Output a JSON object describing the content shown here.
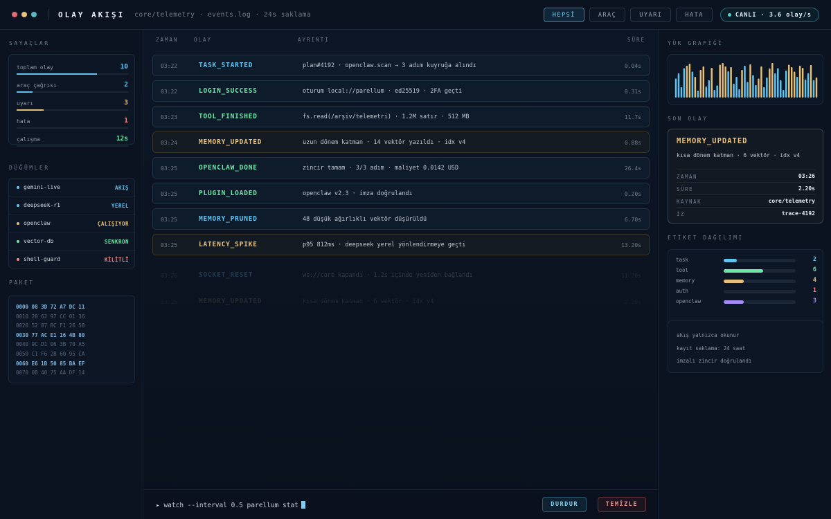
{
  "header": {
    "title": "OLAY AKIŞI",
    "path": "core/telemetry · events.log · 24s saklama",
    "filters": [
      {
        "label": "HEPSİ",
        "active": true
      },
      {
        "label": "ARAÇ",
        "active": false
      },
      {
        "label": "UYARI",
        "active": false
      },
      {
        "label": "HATA",
        "active": false
      }
    ],
    "live": "CANLI · 3.6 olay/s",
    "dot_colors": [
      "#e06c75",
      "#e5c07b",
      "#56b6c2"
    ]
  },
  "counters": {
    "title": "SAYAÇLAR",
    "rows": [
      {
        "label": "toplam olay",
        "value": "10",
        "color": "#61c3f0",
        "fill": 0.72
      },
      {
        "label": "araç çağrısı",
        "value": "2",
        "color": "#61c3f0",
        "fill": 0.14
      },
      {
        "label": "uyarı",
        "value": "3",
        "color": "#e5c07b",
        "fill": 0.24
      },
      {
        "label": "hata",
        "value": "1",
        "color": "#f08a8a",
        "fill": 0.0
      },
      {
        "label": "çalışma",
        "value": "12s",
        "color": "#6ee7a8",
        "fill": 0.0
      }
    ]
  },
  "nodes": {
    "title": "DÜĞÜMLER",
    "rows": [
      {
        "name": "gemini-live",
        "status": "AKIŞ",
        "color": "#61c3f0"
      },
      {
        "name": "deepseek-r1",
        "status": "YEREL",
        "color": "#61c3f0"
      },
      {
        "name": "openclaw",
        "status": "ÇALIŞIYOR",
        "color": "#e5c07b"
      },
      {
        "name": "vector-db",
        "status": "SENKRON",
        "color": "#6ee7a8"
      },
      {
        "name": "shell-guard",
        "status": "KİLİTLİ",
        "color": "#f08a8a"
      }
    ]
  },
  "packet": {
    "title": "PAKET",
    "lines": [
      {
        "text": "0000 08 3D 72 A7 DC 11",
        "highlight": true
      },
      {
        "text": "0010 20 62 97 CC 01 36",
        "highlight": false
      },
      {
        "text": "0020 52 87 BC F1 26 5B",
        "highlight": false
      },
      {
        "text": "0030 77 AC E1 16 4B 80",
        "highlight": true
      },
      {
        "text": "0040 9C D1 06 3B 70 A5",
        "highlight": false
      },
      {
        "text": "0050 C1 F6 2B 60 95 CA",
        "highlight": false
      },
      {
        "text": "0060 E6 1B 50 85 BA EF",
        "highlight": true
      },
      {
        "text": "0070 0B 40 75 AA DF 14",
        "highlight": false
      }
    ]
  },
  "table": {
    "columns": [
      "ZAMAN",
      "OLAY",
      "AYRINTI",
      "SÜRE"
    ],
    "rows": [
      {
        "time": "03:22",
        "name": "TASK_STARTED",
        "detail": "plan#4192 · openclaw.scan → 3 adım kuyruğa alındı",
        "dur": "0.04s",
        "color": "#61c3f0",
        "kind": "info"
      },
      {
        "time": "03:22",
        "name": "LOGIN_SUCCESS",
        "detail": "oturum local://parellum · ed25519 · 2FA geçti",
        "dur": "0.31s",
        "color": "#6ee7a8",
        "kind": "info"
      },
      {
        "time": "03:23",
        "name": "TOOL_FINISHED",
        "detail": "fs.read(/arşiv/telemetri) · 1.2M satır · 512 MB",
        "dur": "11.7s",
        "color": "#6ee7a8",
        "kind": "info"
      },
      {
        "time": "03:24",
        "name": "MEMORY_UPDATED",
        "detail": "uzun dönem katman · 14 vektör yazıldı · idx v4",
        "dur": "0.88s",
        "color": "#e5c07b",
        "kind": "warn"
      },
      {
        "time": "03:25",
        "name": "OPENCLAW_DONE",
        "detail": "zincir tamam · 3/3 adım · maliyet 0.0142 USD",
        "dur": "26.4s",
        "color": "#6ee7a8",
        "kind": "info"
      },
      {
        "time": "03:25",
        "name": "PLUGIN_LOADED",
        "detail": "openclaw v2.3 · imza doğrulandı",
        "dur": "0.20s",
        "color": "#6ee7a8",
        "kind": "info"
      },
      {
        "time": "03:25",
        "name": "MEMORY_PRUNED",
        "detail": "48 düşük ağırlıklı vektör düşürüldü",
        "dur": "6.70s",
        "color": "#61c3f0",
        "kind": "info"
      },
      {
        "time": "03:25",
        "name": "LATENCY_SPIKE",
        "detail": "p95 812ms · deepseek yerel yönlendirmeye geçti",
        "dur": "13.20s",
        "color": "#e5c07b",
        "kind": "warn"
      },
      {
        "time": "03:26",
        "name": "SOCKET_RESET",
        "detail": "ws://core kapandı · 1.2s içinde yeniden bağlandı",
        "dur": "11.20s",
        "color": "#61c3f0",
        "kind": "fade",
        "opacity": 0.22
      },
      {
        "time": "03:26",
        "name": "MEMORY_UPDATED",
        "detail": "kısa dönem katman · 6 vektör · idx v4",
        "dur": "2.20s",
        "color": "#e5c07b",
        "kind": "fade",
        "opacity": 0.12
      }
    ]
  },
  "command": {
    "prompt": "▸ watch --interval 0.5 parellum stat",
    "stop": "DURDUR",
    "clear": "TEMİZLE"
  },
  "load_chart": {
    "title": "YÜK GRAFİĞİ",
    "bars": [
      {
        "v": 0.55,
        "c": "#61c3f0"
      },
      {
        "v": 0.7,
        "c": "#61c3f0"
      },
      {
        "v": 0.3,
        "c": "#61c3f0"
      },
      {
        "v": 0.85,
        "c": "#61c3f0"
      },
      {
        "v": 0.92,
        "c": "#e5c07b"
      },
      {
        "v": 0.98,
        "c": "#e5c07b"
      },
      {
        "v": 0.75,
        "c": "#61c3f0"
      },
      {
        "v": 0.6,
        "c": "#e5c07b"
      },
      {
        "v": 0.2,
        "c": "#61c3f0"
      },
      {
        "v": 0.8,
        "c": "#e5c07b"
      },
      {
        "v": 0.9,
        "c": "#e5c07b"
      },
      {
        "v": 0.32,
        "c": "#61c3f0"
      },
      {
        "v": 0.5,
        "c": "#61c3f0"
      },
      {
        "v": 0.86,
        "c": "#e5c07b"
      },
      {
        "v": 0.22,
        "c": "#61c3f0"
      },
      {
        "v": 0.35,
        "c": "#61c3f0"
      },
      {
        "v": 0.95,
        "c": "#e5c07b"
      },
      {
        "v": 1.0,
        "c": "#e5c07b"
      },
      {
        "v": 0.9,
        "c": "#e5c07b"
      },
      {
        "v": 0.76,
        "c": "#61c3f0"
      },
      {
        "v": 0.88,
        "c": "#e5c07b"
      },
      {
        "v": 0.4,
        "c": "#61c3f0"
      },
      {
        "v": 0.6,
        "c": "#61c3f0"
      },
      {
        "v": 0.24,
        "c": "#61c3f0"
      },
      {
        "v": 0.8,
        "c": "#e5c07b"
      },
      {
        "v": 0.92,
        "c": "#61c3f0"
      },
      {
        "v": 0.45,
        "c": "#61c3f0"
      },
      {
        "v": 0.96,
        "c": "#e5c07b"
      },
      {
        "v": 0.65,
        "c": "#61c3f0"
      },
      {
        "v": 0.36,
        "c": "#61c3f0"
      },
      {
        "v": 0.55,
        "c": "#e5c07b"
      },
      {
        "v": 0.9,
        "c": "#e5c07b"
      },
      {
        "v": 0.3,
        "c": "#61c3f0"
      },
      {
        "v": 0.58,
        "c": "#61c3f0"
      },
      {
        "v": 0.84,
        "c": "#e5c07b"
      },
      {
        "v": 1.0,
        "c": "#e5c07b"
      },
      {
        "v": 0.7,
        "c": "#61c3f0"
      },
      {
        "v": 0.85,
        "c": "#61c3f0"
      },
      {
        "v": 0.5,
        "c": "#61c3f0"
      },
      {
        "v": 0.22,
        "c": "#61c3f0"
      },
      {
        "v": 0.78,
        "c": "#61c3f0"
      },
      {
        "v": 0.95,
        "c": "#e5c07b"
      },
      {
        "v": 0.88,
        "c": "#e5c07b"
      },
      {
        "v": 0.75,
        "c": "#e5c07b"
      },
      {
        "v": 0.6,
        "c": "#61c3f0"
      },
      {
        "v": 0.92,
        "c": "#e5c07b"
      },
      {
        "v": 0.86,
        "c": "#e5c07b"
      },
      {
        "v": 0.52,
        "c": "#61c3f0"
      },
      {
        "v": 0.7,
        "c": "#61c3f0"
      },
      {
        "v": 0.94,
        "c": "#e5c07b"
      },
      {
        "v": 0.5,
        "c": "#61c3f0"
      },
      {
        "v": 0.58,
        "c": "#e5c07b"
      }
    ]
  },
  "last_event": {
    "title": "SON OLAY",
    "name": "MEMORY_UPDATED",
    "detail": "kısa dönem katman · 6 vektör · idx v4",
    "fields": [
      {
        "k": "ZAMAN",
        "v": "03:26"
      },
      {
        "k": "SÜRE",
        "v": "2.20s"
      },
      {
        "k": "KAYNAK",
        "v": "core/telemetry"
      },
      {
        "k": "İZ",
        "v": "trace·4192"
      }
    ]
  },
  "tags": {
    "title": "ETİKET DAĞILIMI",
    "rows": [
      {
        "name": "task",
        "value": "2",
        "fill": 0.18,
        "color": "#61c3f0"
      },
      {
        "name": "tool",
        "value": "6",
        "fill": 0.55,
        "color": "#6ee7a8"
      },
      {
        "name": "memory",
        "value": "4",
        "fill": 0.28,
        "color": "#e5c07b"
      },
      {
        "name": "auth",
        "value": "1",
        "fill": 0.0,
        "color": "#f08a8a"
      },
      {
        "name": "openclaw",
        "value": "3",
        "fill": 0.28,
        "color": "#a78bfa"
      }
    ]
  },
  "notes": [
    "akış yalnızca okunur",
    "kayıt saklama: 24 saat",
    "imzalı zincir doğrulandı"
  ]
}
